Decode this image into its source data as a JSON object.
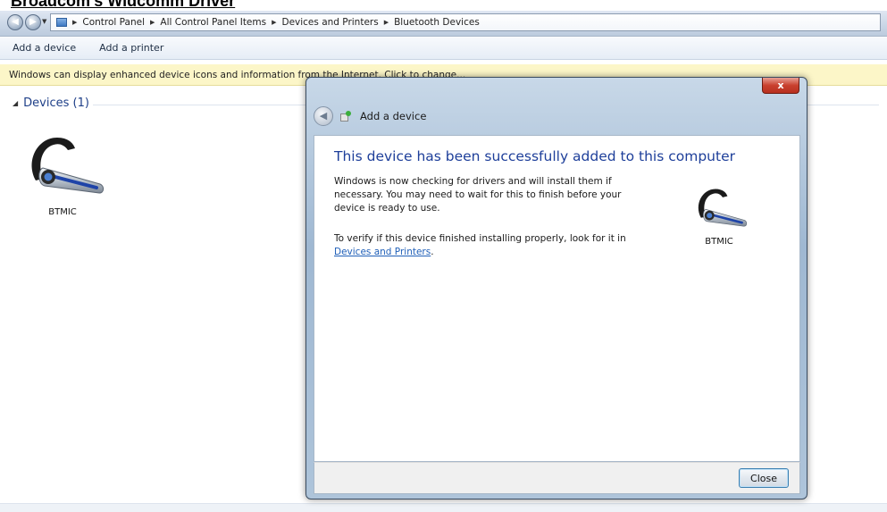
{
  "overlay_title": "Broadcom's Widcomm Driver",
  "address": {
    "crumbs": [
      "Control Panel",
      "All Control Panel Items",
      "Devices and Printers",
      "Bluetooth Devices"
    ]
  },
  "toolbar": {
    "add_device": "Add a device",
    "add_printer": "Add a printer"
  },
  "infobar": {
    "text": "Windows can display enhanced device icons and information from the Internet. Click to change..."
  },
  "devices_group": {
    "label": "Devices (1)",
    "items": [
      {
        "name": "BTMIC"
      }
    ]
  },
  "dialog": {
    "close_x": "x",
    "title": "Add a device",
    "heading": "This device has been successfully added to this computer",
    "para1": "Windows is now checking for drivers and will install them if necessary. You may need to wait for this to finish before your device is ready to use.",
    "para2_prefix": "To verify if this device finished installing properly, look for it in",
    "link": "Devices and Printers",
    "para2_suffix": ".",
    "device_name": "BTMIC",
    "close_button": "Close"
  },
  "colors": {
    "heading_blue": "#1e3f9a",
    "link_blue": "#1f5fb8",
    "infobar_yellow": "#fcf6c8",
    "close_red": "#c9412f"
  },
  "icons": [
    "back-arrow-icon",
    "forward-arrow-icon",
    "control-panel-icon",
    "chevron-right-icon",
    "collapse-arrow-icon",
    "headset-icon",
    "add-device-icon",
    "close-icon"
  ]
}
